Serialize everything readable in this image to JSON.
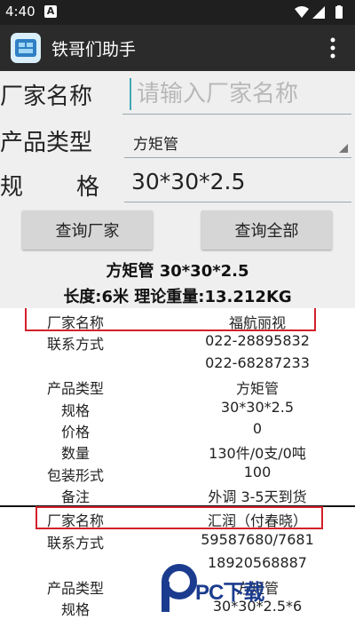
{
  "status_bar": {
    "time": "4:40",
    "notification_icon": "A"
  },
  "app": {
    "title": "铁哥们助手",
    "logo_icon": "app-logo-icon",
    "menu_icon": "overflow-menu-icon"
  },
  "form": {
    "manufacturer_label": "厂家名称",
    "manufacturer_placeholder": "请输入厂家名称",
    "manufacturer_value": "",
    "product_type_label": "产品类型",
    "product_type_value": "方矩管",
    "spec_label_1": "规",
    "spec_label_2": "格",
    "spec_value": "30*30*2.5"
  },
  "buttons": {
    "query_manufacturer": "查询厂家",
    "query_all": "查询全部"
  },
  "summary": {
    "line1": "方矩管 30*30*2.5",
    "line2": "长度:6米 理论重量:13.212KG"
  },
  "records": [
    {
      "rows": [
        {
          "k": "厂家名称",
          "v": "福航丽视"
        },
        {
          "k": "联系方式",
          "v": "022-28895832"
        },
        {
          "k": "",
          "v": "022-68287233"
        },
        {
          "k": "产品类型",
          "v": "方矩管"
        },
        {
          "k": "规格",
          "v": "30*30*2.5"
        },
        {
          "k": "价格",
          "v": "0"
        },
        {
          "k": "数量",
          "v": "130件/0支/0吨"
        },
        {
          "k": "包装形式",
          "v": "100"
        },
        {
          "k": "备注",
          "v": "外调 3-5天到货"
        }
      ]
    },
    {
      "rows": [
        {
          "k": "厂家名称",
          "v": "汇润（付春晓）"
        },
        {
          "k": "联系方式",
          "v": "59587680/7681"
        },
        {
          "k": "",
          "v": "18920568887"
        },
        {
          "k": "产品类型",
          "v": "方矩管"
        },
        {
          "k": "规格",
          "v": "30*30*2.5*6"
        }
      ]
    }
  ],
  "watermark": {
    "text": "PC下载",
    "logo_icon": "pc-download-logo-icon"
  },
  "colors": {
    "highlight_border": "#d3202a",
    "caret": "#3fa8b4",
    "app_bar": "#2b2b2b"
  }
}
